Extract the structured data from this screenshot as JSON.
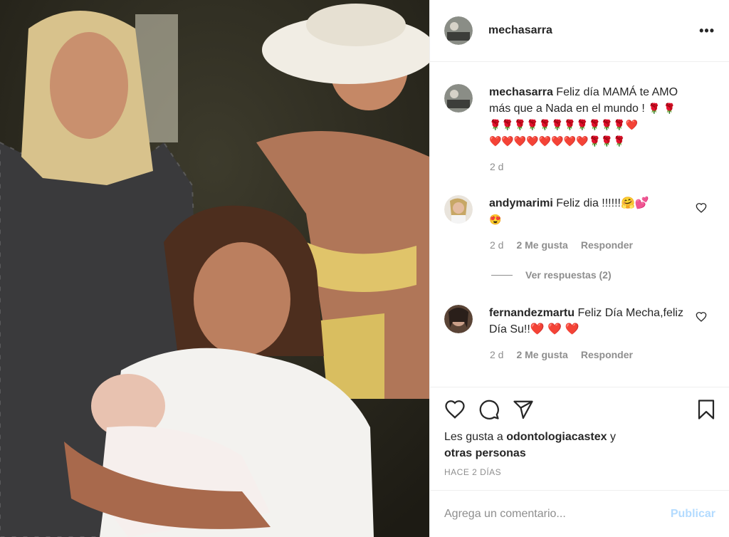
{
  "post": {
    "username": "mechasarra",
    "more_label": "•••"
  },
  "caption": {
    "username": "mechasarra",
    "text": "Feliz día MAMÁ te AMO más que a Nada en el mundo !",
    "emojis_line1": "🌹 🌹",
    "emojis_line2": "🌹🌹🌹🌹🌹🌹🌹🌹🌹🌹🌹❤️",
    "emojis_line3": "❤️❤️❤️❤️❤️❤️❤️❤️🌹🌹🌹",
    "time": "2 d"
  },
  "comments": [
    {
      "username": "andymarimi",
      "text": "Feliz dia !!!!!!🤗💕",
      "text2": "😍",
      "time": "2 d",
      "likes": "2 Me gusta",
      "reply": "Responder",
      "view_replies": "Ver respuestas (2)"
    },
    {
      "username": "fernandezmartu",
      "text": "Feliz Día Mecha,feliz Día Su!!❤️ ❤️ ❤️",
      "time": "2 d",
      "likes": "2 Me gusta",
      "reply": "Responder"
    }
  ],
  "likes_line": {
    "prefix": "Les gusta a",
    "user": "odontologiacastex",
    "suffix": "y",
    "others": "otras personas"
  },
  "time_ago": "HACE 2 DÍAS",
  "add_comment": {
    "placeholder": "Agrega un comentario...",
    "post_label": "Publicar"
  },
  "icons": [
    "heart-icon",
    "comment-icon",
    "share-icon",
    "bookmark-icon",
    "more-icon"
  ]
}
